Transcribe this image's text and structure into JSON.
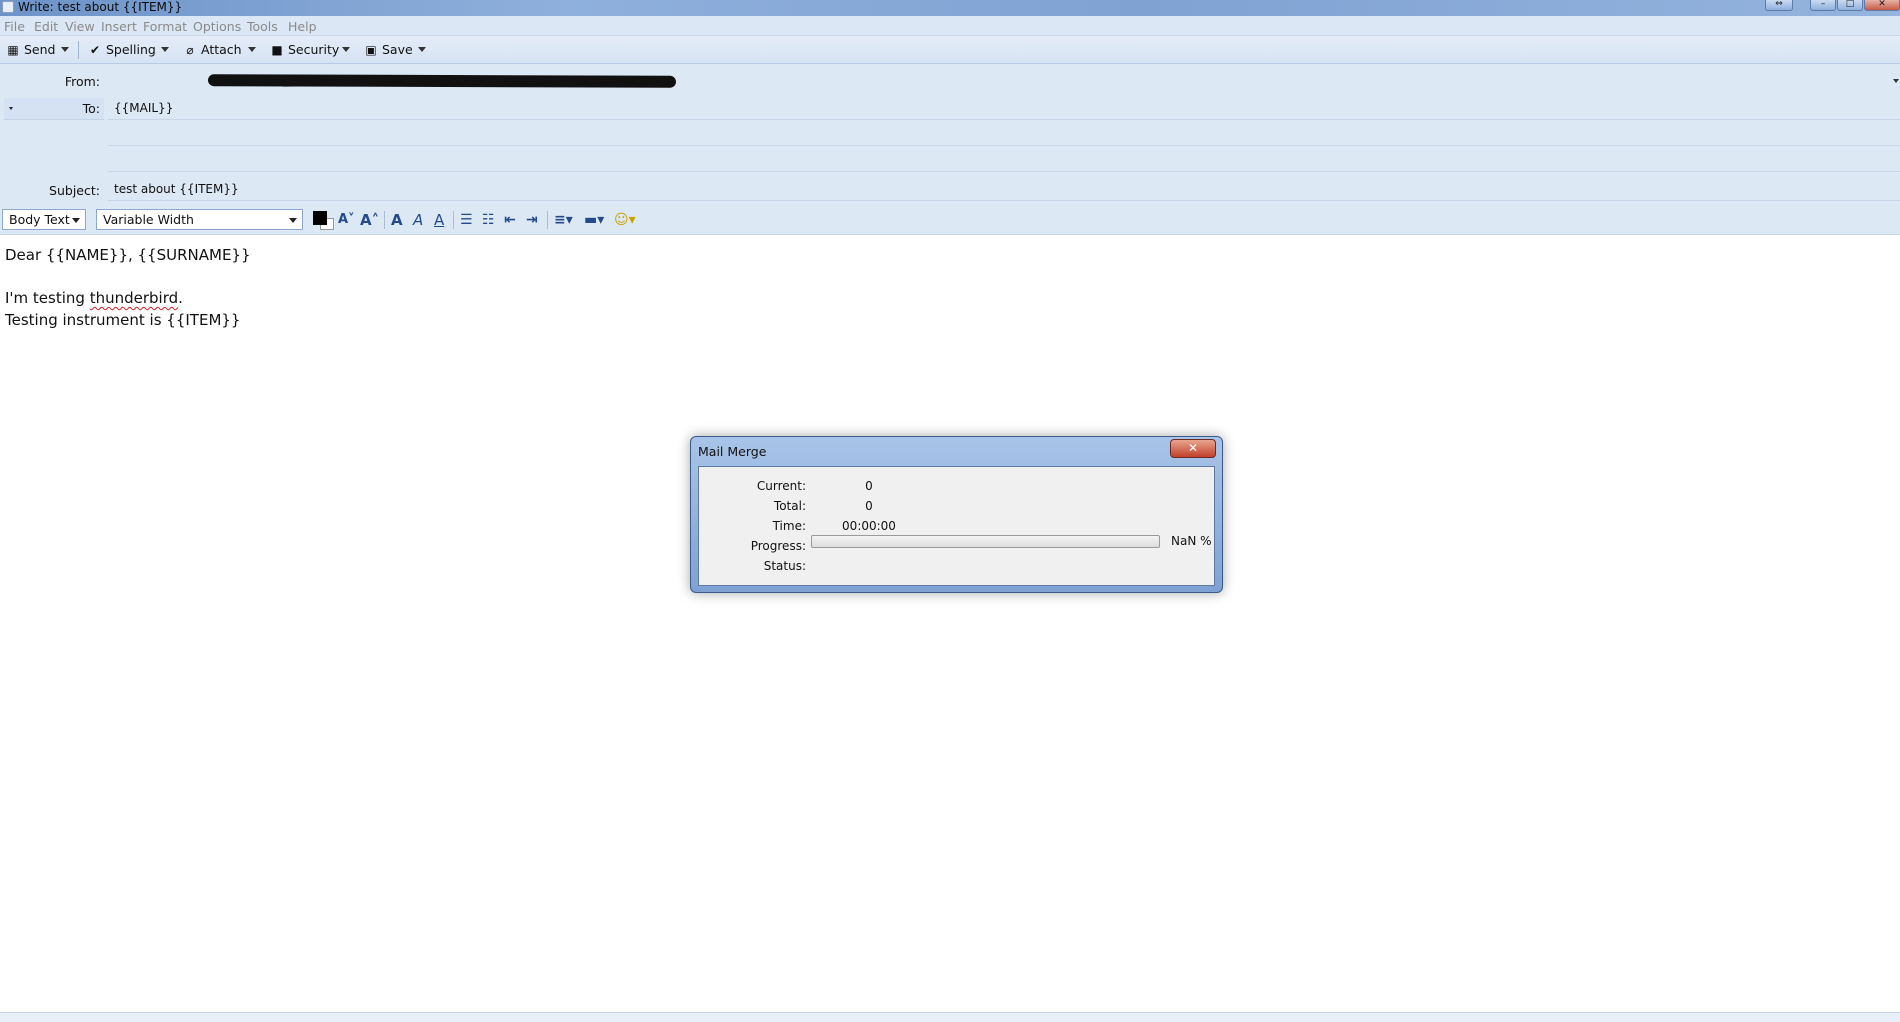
{
  "window": {
    "title": "Write: test about {{ITEM}}",
    "buttons": {
      "restore_down": "⇔",
      "minimize": "–",
      "maximize": "□",
      "close": "✕"
    }
  },
  "menu": [
    "File",
    "Edit",
    "View",
    "Insert",
    "Format",
    "Options",
    "Tools",
    "Help"
  ],
  "toolbar": {
    "send": "Send",
    "spelling": "Spelling",
    "attach": "Attach",
    "security": "Security",
    "save": "Save",
    "icons": {
      "send": "send-icon",
      "spelling": "checkmark-icon",
      "attach": "paperclip-icon",
      "security": "lock-icon",
      "save": "floppy-disk-icon"
    }
  },
  "header": {
    "from_label": "From:",
    "to_label": "To:",
    "to_value": "{{MAIL}}",
    "subject_label": "Subject:",
    "subject_value": "test about {{ITEM}}"
  },
  "format": {
    "paragraph_style": "Body Text",
    "font": "Variable Width",
    "text_color": "#000000",
    "background_color": "#ffffff"
  },
  "body": {
    "line1": "Dear {{NAME}}, {{SURNAME}}",
    "line2_before": "I'm testing ",
    "line2_misspelled": "thunderbird",
    "line2_after": ".",
    "line3": "Testing instrument is {{ITEM}}"
  },
  "dialog": {
    "title": "Mail Merge",
    "close": "✕",
    "current_label": "Current:",
    "current_value": "0",
    "total_label": "Total:",
    "total_value": "0",
    "time_label": "Time:",
    "time_value": "00:00:00",
    "progress_label": "Progress:",
    "progress_fraction": 0,
    "progress_text": "NaN %",
    "status_label": "Status:",
    "status_value": ""
  }
}
